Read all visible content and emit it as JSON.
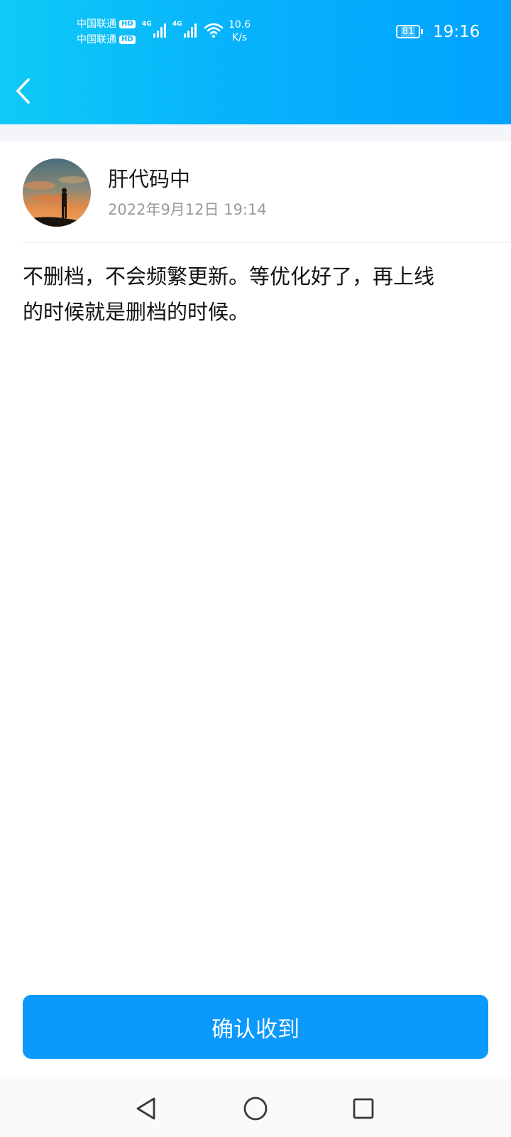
{
  "status_bar": {
    "carrier_1": "中国联通",
    "carrier_2": "中国联通",
    "hd_badge": "HD",
    "network_type_1": "4G",
    "network_type_2": "4G",
    "net_speed_value": "10.6",
    "net_speed_unit": "K/s",
    "battery_level": "81",
    "time": "19:16",
    "icons": [
      "signal-icon",
      "wifi-icon",
      "battery-icon"
    ]
  },
  "nav": {
    "back_icon": "chevron-left-icon"
  },
  "post": {
    "author_name": "肝代码中",
    "timestamp": "2022年9月12日 19:14",
    "body_line_1": "不删档，不会频繁更新。等优化好了，再上线",
    "body_line_2": "的时候就是删档的时候。"
  },
  "actions": {
    "confirm_label": "确认收到"
  },
  "system_nav": {
    "icons": [
      "back-triangle-icon",
      "home-circle-icon",
      "recents-square-icon"
    ]
  },
  "colors": {
    "header_gradient_start": "#0ecbf6",
    "header_gradient_end": "#01a2fe",
    "button": "#0b99fb",
    "secondary_text": "#9a9a9a",
    "gap_background": "#f3f5f8"
  }
}
